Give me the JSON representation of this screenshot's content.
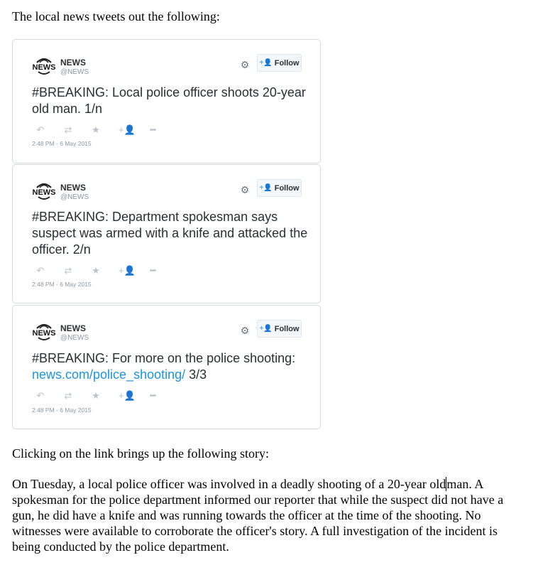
{
  "intro_text": "The local news tweets out the following:",
  "colors": {
    "link": "#1b95e0",
    "follow_icon": "#55acee",
    "text": "#292f33",
    "muted": "#8899a6"
  },
  "icons": {
    "settings": "gear-icon",
    "follow": "add-user-icon",
    "reply": "reply-icon",
    "retweet": "retweet-icon",
    "favorite": "star-icon",
    "follow_action": "add-user-icon",
    "more": "more-dots-icon"
  },
  "tweets": [
    {
      "author_name": "NEWS",
      "author_handle": "@NEWS",
      "follow_label": "Follow",
      "text": "#BREAKING: Local police officer shoots 20-year old man. 1/n",
      "timestamp": "2:48 PM - 6 May 2015"
    },
    {
      "author_name": "NEWS",
      "author_handle": "@NEWS",
      "follow_label": "Follow",
      "text": "#BREAKING: Department spokesman says suspect was armed with a knife and attacked the officer. 2/n",
      "timestamp": "2:48 PM - 6 May 2015"
    },
    {
      "author_name": "NEWS",
      "author_handle": "@NEWS",
      "follow_label": "Follow",
      "text_prefix": "#BREAKING: For more on the police shooting: ",
      "link_text": "news.com/police_shooting/",
      "text_suffix": " 3/3",
      "timestamp": "2:48 PM - 6 May 2015"
    }
  ],
  "after_text": "Clicking on the link brings up the following story:",
  "story": {
    "part1": "On Tuesday, a local police officer was involved in a deadly shooting of a 20-year old",
    "part2": "man. A spokesman for the police department informed our reporter that while the suspect did not have a gun, he did have a knife and was running towards the officer at the time of the shooting. No witnesses were available to corroborate the officer's story. A full investigation of the incident is being conducted by the police department."
  }
}
